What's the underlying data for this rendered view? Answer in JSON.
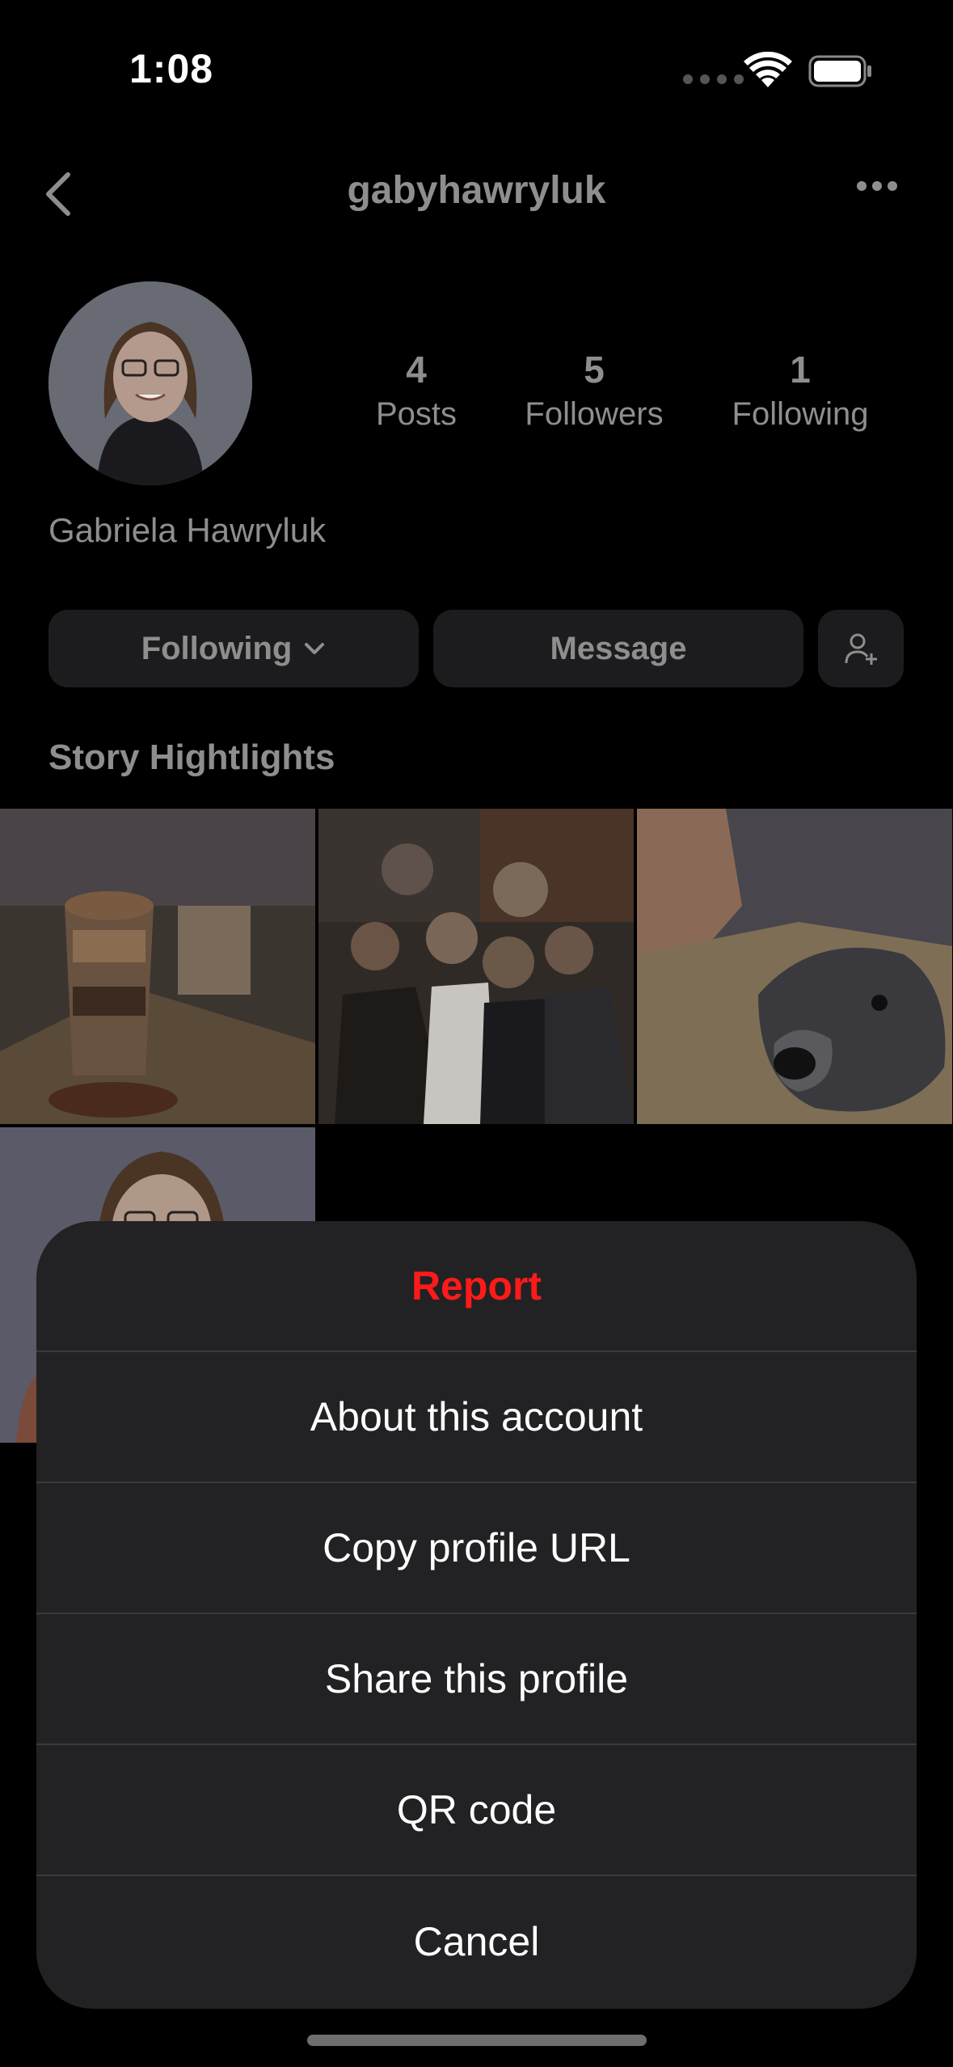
{
  "status_bar": {
    "time": "1:08"
  },
  "header": {
    "username": "gabyhawryluk"
  },
  "profile": {
    "full_name": "Gabriela Hawryluk",
    "stats": [
      {
        "value": "4",
        "label": "Posts"
      },
      {
        "value": "5",
        "label": "Followers"
      },
      {
        "value": "1",
        "label": "Following"
      }
    ]
  },
  "actions": {
    "following_label": "Following",
    "message_label": "Message"
  },
  "highlights_title": "Story Hightlights",
  "action_sheet": {
    "items": [
      "Report",
      "About this account",
      "Copy profile URL",
      "Share this profile",
      "QR code",
      "Cancel"
    ]
  },
  "colors": {
    "report": "#ff1a1a",
    "sheet_bg": "#222224",
    "muted": "#8e8e8e"
  },
  "icons": [
    "back-chevron-icon",
    "more-dots-icon",
    "chevron-down-icon",
    "add-person-icon",
    "wifi-icon",
    "battery-icon",
    "signal-icon"
  ]
}
